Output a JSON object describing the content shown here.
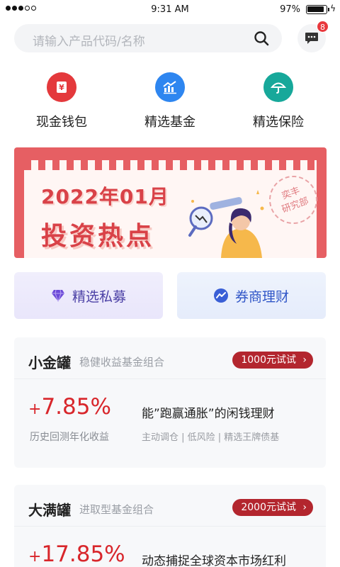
{
  "status_bar": {
    "time": "9:31 AM",
    "battery": "97%"
  },
  "search": {
    "placeholder": "请输入产品代码/名称"
  },
  "messages": {
    "badge_count": "8"
  },
  "quick_menu": [
    {
      "label": "现金钱包",
      "icon": "yen-envelope-icon",
      "color": "#e4393c"
    },
    {
      "label": "精选基金",
      "icon": "growth-chart-icon",
      "color": "#2e86f0"
    },
    {
      "label": "精选保险",
      "icon": "umbrella-icon",
      "color": "#17a89a"
    }
  ],
  "banner": {
    "date_text": "2022年01月",
    "title": "投资热点",
    "stamp_line1": "奕丰",
    "stamp_line2": "研究部"
  },
  "promos": [
    {
      "label": "精选私募",
      "icon": "diamond-icon",
      "color": "#6c4ad8"
    },
    {
      "label": "券商理财",
      "icon": "trend-icon",
      "color": "#3a5fd6"
    }
  ],
  "products": [
    {
      "name": "小金罐",
      "subtitle": "稳健收益基金组合",
      "trial_label": "1000元试试",
      "rate_sign": "+",
      "rate": "7.85%",
      "rate_label": "历史回测年化收益",
      "headline": "能”跑赢通胀”的闲钱理财",
      "tags": "主动调仓 | 低风险 | 精选王牌债基"
    },
    {
      "name": "大满罐",
      "subtitle": "进取型基金组合",
      "trial_label": "2000元试试",
      "rate_sign": "+",
      "rate": "17.85%",
      "headline": "动态捕捉全球资本市场红利"
    }
  ]
}
